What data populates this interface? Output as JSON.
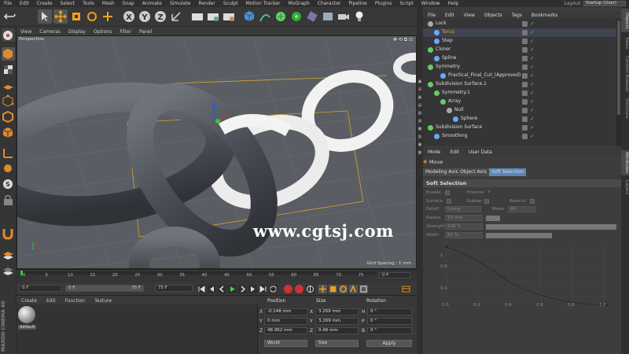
{
  "menu": [
    "File",
    "Edit",
    "Create",
    "Select",
    "Tools",
    "Mesh",
    "Snap",
    "Animate",
    "Simulate",
    "Render",
    "Sculpt",
    "Motion Tracker",
    "MoGraph",
    "Character",
    "Pipeline",
    "Plugins",
    "Script",
    "Window",
    "Help"
  ],
  "layout": {
    "label": "Layout:",
    "value": "Startup (User)"
  },
  "viewport": {
    "menu": [
      "View",
      "Cameras",
      "Display",
      "Options",
      "Filter",
      "Panel"
    ],
    "camera": "Perspective",
    "grid_spacing": "Grid Spacing : 1 mm",
    "watermark": "www.cgtsj.com"
  },
  "timeline": {
    "ticks": [
      "0",
      "5",
      "10",
      "15",
      "20",
      "25",
      "30",
      "35",
      "40",
      "45",
      "50",
      "55",
      "60",
      "65",
      "70",
      "75"
    ],
    "current_frame": "0 F"
  },
  "playback": {
    "start": "0 F",
    "min": "0 F",
    "max": "75 F",
    "end": "75 F"
  },
  "materials": {
    "menu": [
      "Create",
      "Edit",
      "Function",
      "Texture"
    ],
    "items": [
      {
        "name": "default"
      }
    ],
    "brand": "MAXON CINEMA 4D"
  },
  "coordinates": {
    "headers": {
      "position": "Position",
      "size": "Size",
      "rotation": "Rotation"
    },
    "rows": [
      {
        "pl": "X",
        "pv": "-0.148 mm",
        "sl": "X",
        "sv": "3.269 mm",
        "rl": "H",
        "rv": "0 °"
      },
      {
        "pl": "Y",
        "pv": "0 mm",
        "sl": "Y",
        "sv": "3.269 mm",
        "rl": "P",
        "rv": "0 °"
      },
      {
        "pl": "Z",
        "pv": "48.962 mm",
        "sl": "Z",
        "sv": "0.46 mm",
        "rl": "B",
        "rv": "0 °"
      }
    ],
    "mode_world": "World",
    "mode_size": "Size",
    "apply": "Apply"
  },
  "objects": {
    "menu": [
      "File",
      "Edit",
      "View",
      "Objects",
      "Tags",
      "Bookmarks"
    ],
    "items": [
      {
        "name": "Lock",
        "depth": 0,
        "color": "#aaaaaa"
      },
      {
        "name": "Torus",
        "depth": 1,
        "color": "#66aaff",
        "highlight": true
      },
      {
        "name": "Step",
        "depth": 1,
        "color": "#66aaff"
      },
      {
        "name": "Cloner",
        "depth": 0,
        "color": "#66cc66"
      },
      {
        "name": "Spline",
        "depth": 1,
        "color": "#66aaff"
      },
      {
        "name": "Symmetry",
        "depth": 0,
        "color": "#66cc66"
      },
      {
        "name": "Practical_Final_Cut_(Approved)",
        "depth": 2,
        "color": "#66aaff"
      },
      {
        "name": "Subdivision Surface.1",
        "depth": 0,
        "color": "#66cc66"
      },
      {
        "name": "Symmetry.1",
        "depth": 1,
        "color": "#66cc66"
      },
      {
        "name": "Array",
        "depth": 2,
        "color": "#66cc66"
      },
      {
        "name": "Null",
        "depth": 3,
        "color": "#aaaaaa"
      },
      {
        "name": "Sphere",
        "depth": 4,
        "color": "#66aaff"
      },
      {
        "name": "Subdivision Surface",
        "depth": 0,
        "color": "#66cc66"
      },
      {
        "name": "Smoothing",
        "depth": 1,
        "color": "#66aaff"
      }
    ]
  },
  "side_tabs": [
    "Objects",
    "Takes",
    "Content Browser",
    "Structure"
  ],
  "side_tabs_lower": [
    "Attributes",
    "Layers"
  ],
  "attributes": {
    "menu": [
      "Mode",
      "Edit",
      "User Data"
    ],
    "title": "Move",
    "tabs": [
      "Modeling Axis",
      "Object Axis",
      "Soft Selection"
    ],
    "active_tab": "Soft Selection",
    "section": "Soft Selection",
    "enable_label": "Enable",
    "preview_label": "Preview",
    "surface_label": "Surface",
    "rubber_label": "Rubber",
    "restrict_label": "Restrict",
    "falloff_label": "Falloff",
    "falloff_value": "Linear",
    "mode_label": "Mode",
    "mode_value": "All",
    "radius_label": "Radius",
    "radius_value": "10 mm",
    "strength_label": "Strength",
    "strength_value": "100 %",
    "width_label": "Width",
    "width_value": "50 %",
    "curve_y_ticks": [
      "1",
      "0.8",
      "0.4"
    ],
    "curve_x_ticks": [
      "0.0",
      "0.2",
      "0.4",
      "0.6",
      "0.8",
      "1.0"
    ]
  },
  "colors": {
    "accent": "#f0a020",
    "selection": "#4a6fa0",
    "highlight_tab": "#5b86b8"
  }
}
